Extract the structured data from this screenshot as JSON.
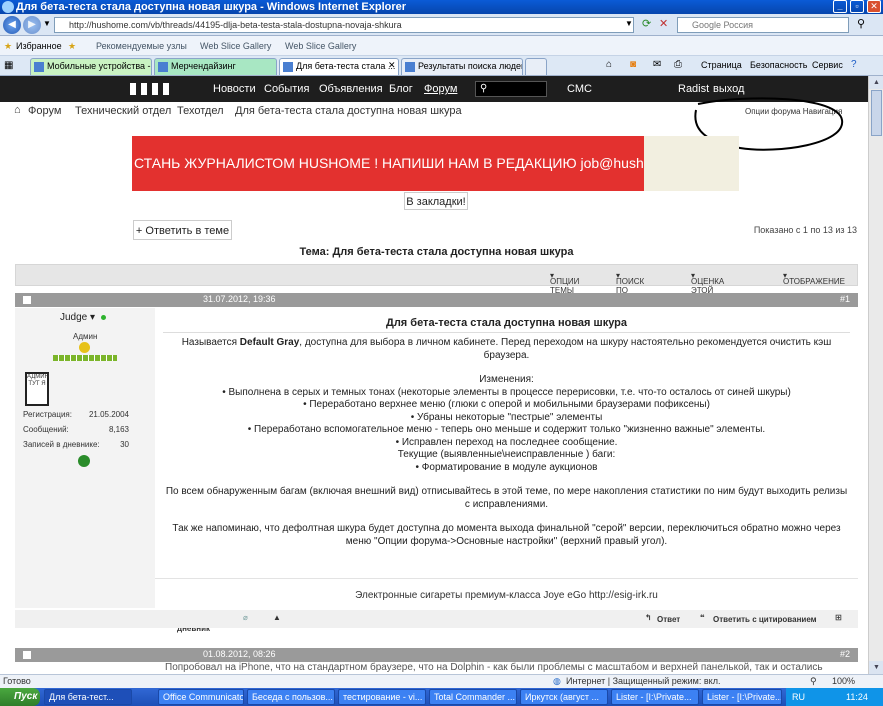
{
  "window": {
    "title": "Для бета-теста стала доступна новая шкура - Windows Internet Explorer"
  },
  "browser": {
    "url": "http://hushome.com/vb/threads/44195-dlja-beta-testa-stala-dostupna-novaja-shkura",
    "search_placeholder": "Google Россия",
    "favorites_label": "Избранное",
    "favorites_bar": [
      "Рекомендуемые узлы",
      "Web Slice Gallery",
      "Web Slice Gallery"
    ],
    "tabs": [
      {
        "label": "Мобильные устройства - U..."
      },
      {
        "label": "Мерчендайзинг"
      },
      {
        "label": "Для бета-теста стала ..."
      },
      {
        "label": "Результаты поиска людей..."
      }
    ],
    "commands": [
      "Страница",
      "Безопасность",
      "Сервис"
    ]
  },
  "site_nav": {
    "items": [
      "Новости",
      "События",
      "Объявления",
      "Блог",
      "Форум",
      "СМС"
    ],
    "user": "Radist",
    "logout": "выход"
  },
  "breadcrumb": [
    "Форум",
    "Технический отдел",
    "Техотдел",
    "Для бета-теста стала доступна новая шкура"
  ],
  "forum_options": {
    "options": "Опции форума",
    "navigation": "Навигация"
  },
  "banner": {
    "text": "СТАНЬ ЖУРНАЛИСТОМ HUSHOME ! НАПИШИ НАМ В РЕДАКЦИЮ job@hushome.com"
  },
  "bookmark_button": "В закладки!",
  "reply_button": "+ Ответить в теме",
  "post_count": "Показано с 1 по 13 из 13",
  "thread_title": "Тема: Для бета-теста стала доступна новая шкура",
  "thread_tools": [
    "ОПЦИИ ТЕМЫ",
    "ПОИСК ПО ТЕМЕ",
    "ОЦЕНКА ЭТОЙ ТЕМЫ",
    "ОТОБРАЖЕНИЕ"
  ],
  "post1": {
    "date": "31.07.2012, 19:36",
    "number": "#1",
    "author": "Judge",
    "role": "Админ",
    "badge": "АДМИН ТУТ Я",
    "stats": [
      {
        "label": "Регистрация:",
        "value": "21.05.2004"
      },
      {
        "label": "Сообщений:",
        "value": "8,163"
      },
      {
        "label": "Записей в дневнике:",
        "value": "30"
      }
    ],
    "title": "Для бета-теста стала доступна новая шкура",
    "intro_pre": "Называется ",
    "intro_bold": "Default Gray",
    "intro_post": ", доступна для выбора в личном кабинете. Перед переходом на шкуру настоятельно рекомендуется очистить кэш браузера.",
    "changes_header": "Изменения:",
    "changes": [
      "• Выполнена в серых и темных тонах (некоторые элементы в процессе перерисовки, т.е. что-то осталось от синей шкуры)",
      "• Переработано верхнее меню (глюки с оперой и мобильными браузерами пофиксены)",
      "• Убраны некоторые \"пестрые\" элементы",
      "• Переработано вспомогательное меню - теперь оно меньше и содержит только \"жизненно важные\" элементы.",
      "• Исправлен переход на последнее сообщение."
    ],
    "bugs_header": "Текущие (выявленные\\неисправленные ) баги:",
    "bugs": [
      "• Форматирование в модуле аукционов"
    ],
    "para2": "По всем обнаруженным багам (включая внешний вид) отписывайтесь в этой теме, по мере накопления статистики по ним будут выходить релизы с исправлениями.",
    "para3": "Так же напоминаю, что дефолтная шкура будет доступна до момента выхода финальной \"серой\" версии, переключиться обратно можно через меню \"Опции форума->Основные настройки\" (верхний правый угол).",
    "signature": "Электронные сигареты премиум-класса Joye eGo http://esig-irk.ru",
    "blog_link": "В дневник",
    "reply_link": "Ответ",
    "quote_link": "Ответить с цитированием"
  },
  "post2": {
    "date": "01.08.2012, 08:26",
    "number": "#2",
    "preview": "Попробовал на iPhone, что на стандартном браузере, что на Dolphin - как были проблемы с масштабом и верхней панелькой, так и остались"
  },
  "statusbar": {
    "left": "Готово",
    "zone": "Интернет | Защищенный режим: вкл.",
    "zoom": "100%"
  },
  "taskbar": {
    "start": "Пуск",
    "tasks": [
      "Для бета-тест...",
      "Office Communicator",
      "Беседа с пользов...",
      "тестирование - vi...",
      "Total Commander ...",
      "Иркутск (август ...",
      "Lister - [I:\\Private...",
      "Lister - [I:\\Private..."
    ],
    "lang": "RU",
    "clock": "11:24"
  }
}
